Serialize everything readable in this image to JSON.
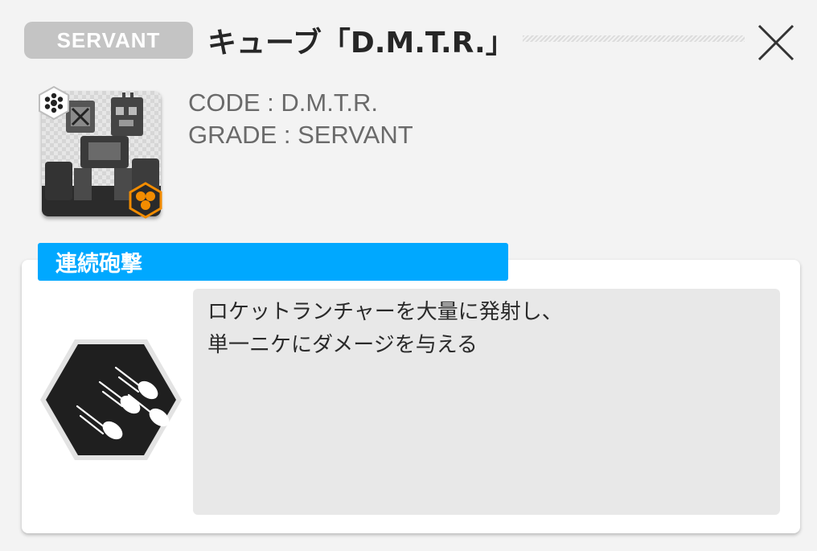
{
  "header": {
    "grade_badge": "SERVANT",
    "title": "キューブ「D.M.T.R.」",
    "close_icon": "close-x-icon"
  },
  "unit": {
    "code_line": "CODE : D.M.T.R.",
    "grade_line": "GRADE : SERVANT",
    "class_icon": "cluster-icon",
    "burst_icon": "burst-cells-icon"
  },
  "skill": {
    "name": "連続砲撃",
    "icon": "rocket-barrage-icon",
    "description_lines": [
      "ロケットランチャーを大量に発射し、",
      "単一ニケにダメージを与える"
    ]
  },
  "colors": {
    "accent": "#00a8ff",
    "burst": "#f28c00",
    "badge": "#c4c4c4"
  }
}
